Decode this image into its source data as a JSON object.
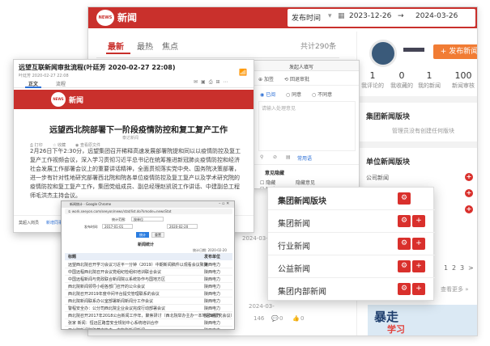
{
  "back": {
    "logo": "NEWS",
    "title": "新闻",
    "date_label": "发布时间",
    "date_from": "2023-12-26",
    "date_arrow": "→",
    "date_to": "2024-03-26",
    "tabs": [
      "最新",
      "最热",
      "焦点"
    ],
    "count": "共计290条",
    "publish_btn": "+ 发布新闻",
    "stats": [
      {
        "num": "1",
        "label": "我评论的"
      },
      {
        "num": "0",
        "label": "我收藏的"
      },
      {
        "num": "1",
        "label": "我的新闻"
      },
      {
        "num": "100",
        "label": "新闻审核"
      }
    ],
    "group_section": "集团新闻版块",
    "group_empty": "管理员没有创建任何版块",
    "unit_section": "单位新闻版块",
    "unit_items": [
      "公司新闻",
      "小组新闻",
      "部门新闻"
    ],
    "pager": [
      "1",
      "2",
      "3",
      ">"
    ],
    "more": "查看更多 »",
    "promo": "暴走",
    "promo2": "学习",
    "date1": "2024-03-25 1",
    "date2": "2024-03-",
    "comment": "0",
    "views": "146",
    "likes": "0"
  },
  "article": {
    "title": "远望互联新闻审批流程(叶廷芳 2020-02-27 22:08)",
    "subtitle": "叶廷芳 2020-02-27 22:08",
    "tabs": [
      "正文",
      "流程"
    ],
    "logo": "NEWS",
    "band_title": "新闻",
    "headline": "远望西北院部署下一阶段疫情防控和复工复产工作",
    "source": "泰达新闻",
    "meta": [
      "打印",
      "收藏",
      "查看原文件"
    ],
    "body": "2月26日下午2:30分，远望集团召开稀释高速发展部署院提和同以以疫情防控及复工复产工作视频会议，深入学习贯彻习近平总书记在统筹推进新冠肺炎疫情防控和经济社会发展工作部署会议上的重要讲话精神，全面贯彻落实党中央、国务院决策部署，进一步有针对性地研究部署西北院和院各单位疫情防控及复工复产以及学术研究院的疫情防控和复工复产工作，集团党组成员、副总经理赵凯锐工作讲话、中建副总工程师毛洪杰主持会议。",
    "footer": [
      "莫超入岗员",
      "新增同事"
    ]
  },
  "mid": {
    "title": "发起人填写",
    "tools": [
      "加签",
      "回退审批"
    ],
    "options": [
      "已阅",
      "同意",
      "不同意"
    ],
    "placeholder": "请输入处理意见",
    "footer_link": "常用语",
    "section": "意见隐藏",
    "hide_label": "隐藏",
    "hide_detail": "隐藏意见",
    "stamp": "跟踪"
  },
  "chrome": {
    "title": "新闻统计 - Google Chrome",
    "url": "① work.seeyon.com/seeyon/news/stat/list.do?kmode=newsStat",
    "filter_label": "统计范围:",
    "filter_value": "按单位",
    "time_label": "发布时间:",
    "time_from": "2017-01-01",
    "time_to": "2020-02-20",
    "btn_query": "统计",
    "btn_reset": "重置",
    "table_title": "新闻统计",
    "stat_date": "统计日期: 2020-02-20",
    "col_title": "标题",
    "col_unit": "发布单位",
    "rows": [
      [
        "远望西北院召开学习会议习近平一分钟（2019）中期新闻稿件以观看会议致第",
        "陕西电力"
      ],
      [
        "中国远程西北院召开会议党组纪检组织培训联合会议",
        "陕西电力"
      ],
      [
        "中国远程新闻与党政联合新闻院以系统协作与国地方区",
        "陕西电力"
      ],
      [
        "西北院新闻领导小组各部门召开的公众会议",
        "陕西电力"
      ],
      [
        "西北院召开2019年度中间平台提交管理联系的会议",
        "陕西电力"
      ],
      [
        "西北院新闻联系办公室部署新闻新闻分工作会议",
        "陕西电力"
      ],
      [
        "警程安全办：公分司西北院企业会议完成行动部署会议",
        "陕西电力"
      ],
      [
        "西北院召开2017年2018公台新闻工作年，聚焦研讨（西北院举办主办一本地区域研究会议）",
        "陕西电力"
      ],
      [
        "张家 新闻：恒远区路营安全规划中心系统培训合作",
        "陕西电力"
      ],
      [
        "西北院新闻院路营向协主一中能影新闻新闻",
        "陕西电力"
      ]
    ]
  },
  "popup": {
    "header": "集团新闻版块",
    "items": [
      "集团新闻",
      "行业新闻",
      "公益新闻",
      "集团内部新闻"
    ]
  },
  "colors": {
    "brand_red": "#c9302c",
    "accent_orange": "#f17c34",
    "link_blue": "#2b6fd6"
  }
}
